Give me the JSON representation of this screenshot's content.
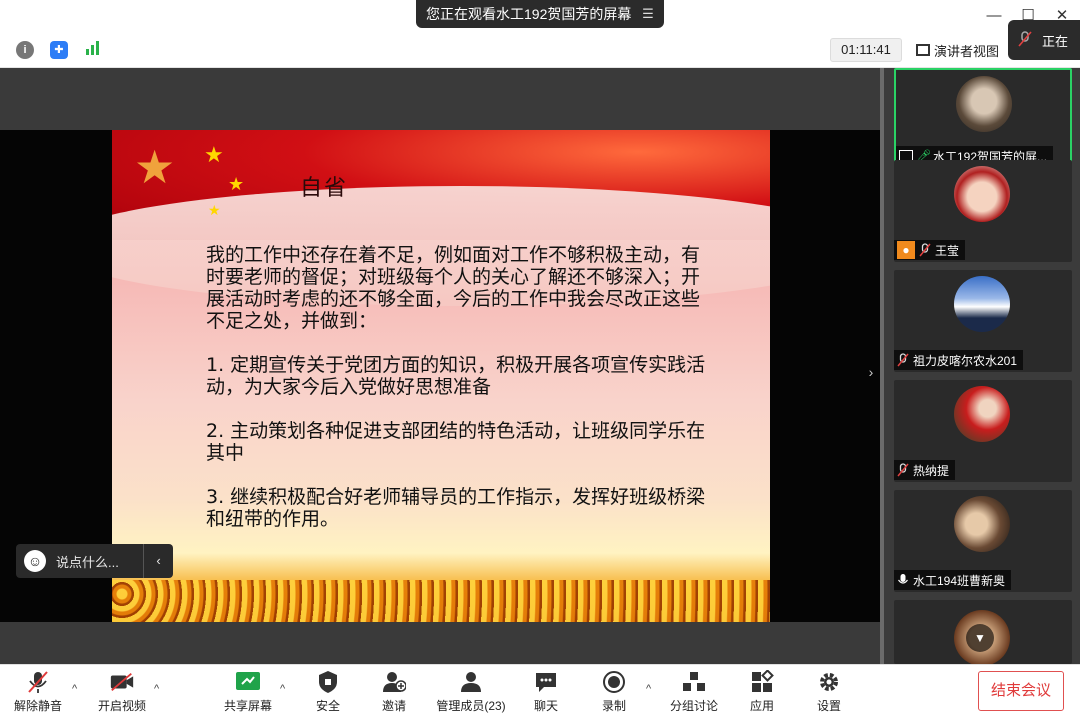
{
  "title_bar": {
    "share_banner": "您正在观看水工192贺国芳的屏幕",
    "talking_label": "正在"
  },
  "info_bar": {
    "timer": "01:11:41",
    "view_label": "演讲者视图"
  },
  "slide": {
    "title": "自省",
    "paragraph": "我的工作中还存在着不足，例如面对工作不够积极主动，有时要老师的督促；对班级每个人的关心了解还不够深入；开展活动时考虑的还不够全面，今后的工作中我会尽改正这些不足之处，并做到：",
    "items": [
      "1. 定期宣传关于党团方面的知识，积极开展各项宣传实践活动，为大家今后入党做好思想准备",
      "2. 主动策划各种促进支部团结的特色活动，让班级同学乐在其中",
      "3. 继续积极配合好老师辅导员的工作指示，发挥好班级桥梁和纽带的作用。"
    ]
  },
  "chat": {
    "placeholder": "说点什么..."
  },
  "participants": [
    {
      "name": "水工192贺国芳的屏...",
      "active": true
    },
    {
      "name": "王莹"
    },
    {
      "name": "祖力皮喀尔农水201"
    },
    {
      "name": "热纳提"
    },
    {
      "name": "水工194班曹新奥"
    }
  ],
  "toolbar": {
    "unmute": "解除静音",
    "start_video": "开启视频",
    "share_screen": "共享屏幕",
    "security": "安全",
    "invite": "邀请",
    "manage_members": "管理成员(23)",
    "chat": "聊天",
    "record": "录制",
    "breakout": "分组讨论",
    "apps": "应用",
    "settings": "设置",
    "end_meeting": "结束会议"
  },
  "colors": {
    "accent_green": "#2ad265",
    "end_red": "#e03a3a"
  }
}
